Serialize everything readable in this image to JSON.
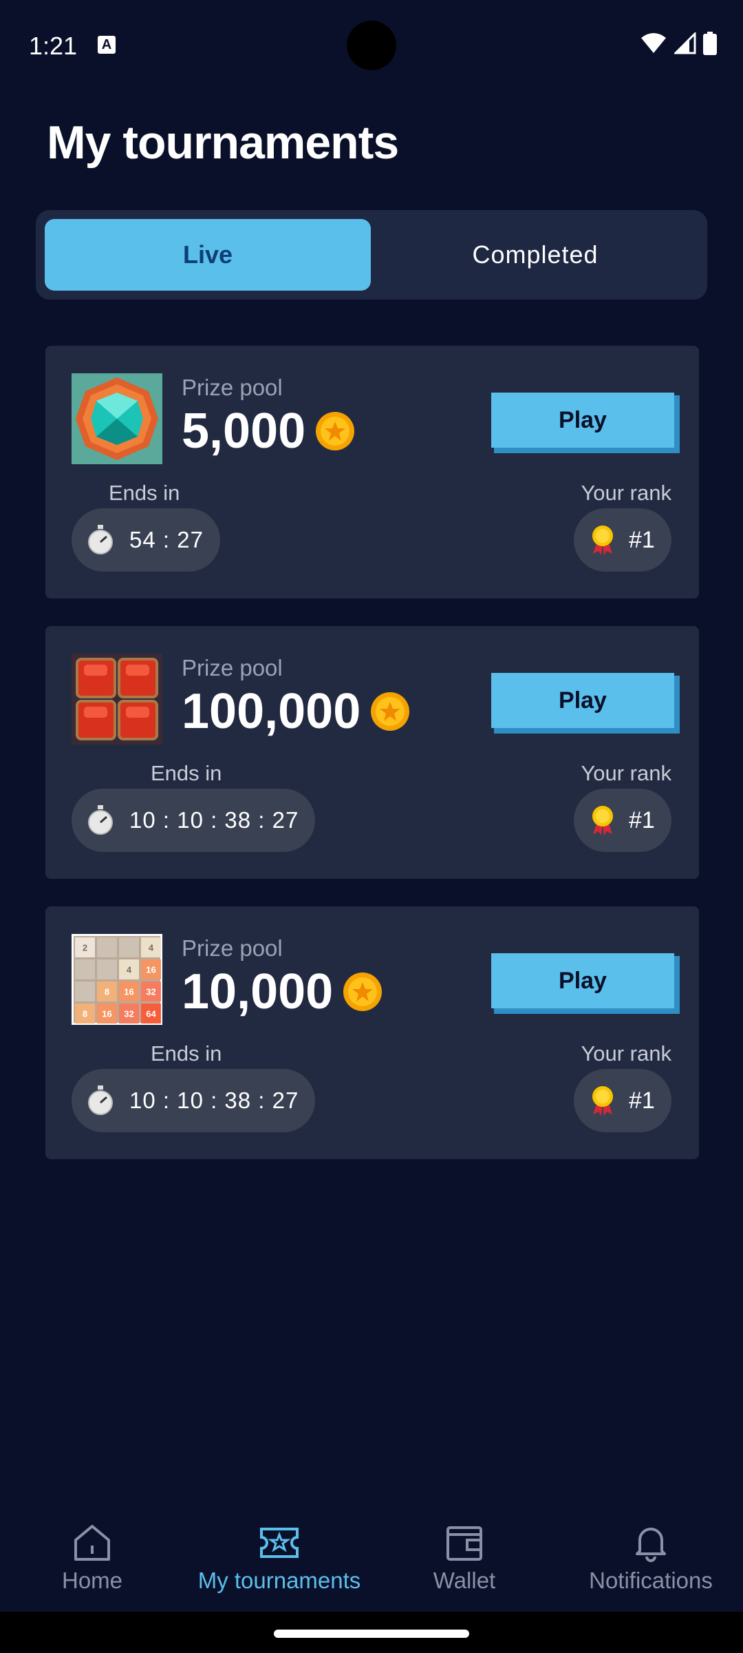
{
  "status_bar": {
    "time": "1:21",
    "badge": "A"
  },
  "page": {
    "title": "My tournaments"
  },
  "tabs": [
    {
      "label": "Live",
      "selected": true
    },
    {
      "label": "Completed",
      "selected": false
    }
  ],
  "tournaments": [
    {
      "game_icon": "gem-icon",
      "prize_label": "Prize pool",
      "prize_value": "5,000",
      "play_label": "Play",
      "ends_label": "Ends in",
      "timer": "54 : 27",
      "rank_label": "Your rank",
      "rank": "#1"
    },
    {
      "game_icon": "red-blocks-icon",
      "prize_label": "Prize pool",
      "prize_value": "100,000",
      "play_label": "Play",
      "ends_label": "Ends in",
      "timer": "10 : 10 : 38 : 27",
      "rank_label": "Your rank",
      "rank": "#1"
    },
    {
      "game_icon": "number-grid-2048-icon",
      "prize_label": "Prize pool",
      "prize_value": "10,000",
      "play_label": "Play",
      "ends_label": "Ends in",
      "timer": "10 : 10 : 38 : 27",
      "rank_label": "Your rank",
      "rank": "#1"
    }
  ],
  "grid_2048": [
    "2",
    "",
    "",
    "4",
    "",
    "",
    "4",
    "16",
    "",
    "8",
    "16",
    "32",
    "8",
    "16",
    "32",
    "64"
  ],
  "bottom_nav": [
    {
      "label": "Home",
      "icon": "home-icon",
      "active": false
    },
    {
      "label": "My tournaments",
      "icon": "ticket-star-icon",
      "active": true
    },
    {
      "label": "Wallet",
      "icon": "wallet-icon",
      "active": false
    },
    {
      "label": "Notifications",
      "icon": "bell-icon",
      "active": false
    }
  ],
  "colors": {
    "background": "#0a1029",
    "card": "#222a42",
    "accent": "#5bbfec",
    "pill": "#3a4153"
  }
}
